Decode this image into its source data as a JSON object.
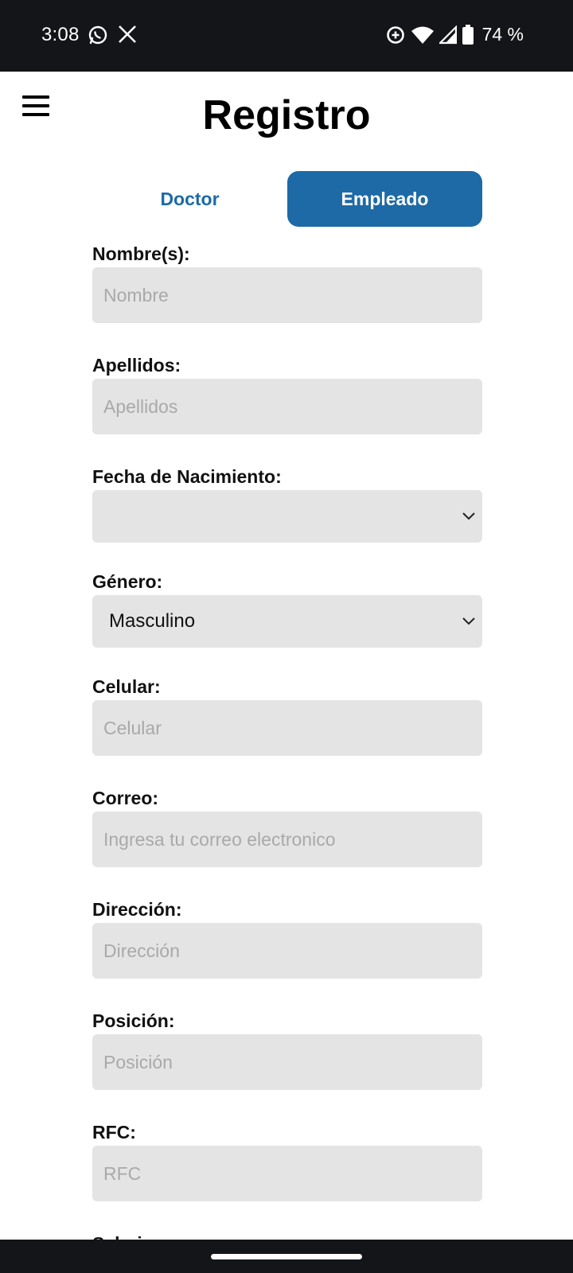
{
  "status_bar": {
    "time": "3:08",
    "battery_text": "74 %",
    "icons": [
      "whatsapp-icon",
      "x-icon",
      "data-saver-icon",
      "wifi-icon",
      "signal-icon",
      "battery-icon"
    ]
  },
  "header": {
    "title": "Registro",
    "menu_icon": "hamburger-menu-icon"
  },
  "tabs": {
    "doctor": "Doctor",
    "empleado": "Empleado",
    "active": "empleado"
  },
  "form": {
    "nombre": {
      "label": "Nombre(s):",
      "placeholder": "Nombre",
      "value": ""
    },
    "apellidos": {
      "label": "Apellidos:",
      "placeholder": "Apellidos",
      "value": ""
    },
    "fecha": {
      "label": "Fecha de Nacimiento:",
      "value": ""
    },
    "genero": {
      "label": "Género:",
      "value": "Masculino"
    },
    "celular": {
      "label": "Celular:",
      "placeholder": "Celular",
      "value": ""
    },
    "correo": {
      "label": "Correo:",
      "placeholder": "Ingresa tu correo electronico",
      "value": ""
    },
    "direccion": {
      "label": "Dirección:",
      "placeholder": "Dirección",
      "value": ""
    },
    "posicion": {
      "label": "Posición:",
      "placeholder": "Posición",
      "value": ""
    },
    "rfc": {
      "label": "RFC:",
      "placeholder": "RFC",
      "value": ""
    },
    "salario": {
      "label": "Salario:"
    }
  },
  "colors": {
    "accent": "#1d6aa6",
    "input_bg": "#e4e4e4",
    "status_bar_bg": "#141519"
  }
}
